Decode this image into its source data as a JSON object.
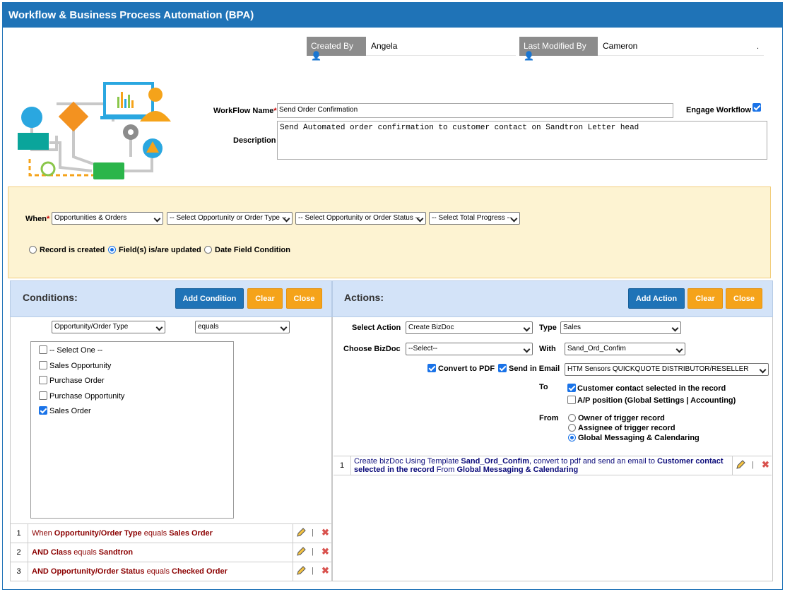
{
  "title": "Workflow & Business Process Automation (BPA)",
  "meta": {
    "created_by_label": "Created By",
    "created_by_value": "Angela",
    "modified_by_label": "Last Modified By",
    "modified_by_value": "Cameron",
    "trailing_dot": "."
  },
  "form": {
    "name_label": "WorkFlow Name",
    "name_value": "Send Order Confirmation",
    "description_label": "Description",
    "description_value": "Send Automated order confirmation to customer contact on Sandtron Letter head",
    "engage_label": "Engage Workflow",
    "engage_checked": true
  },
  "when": {
    "label": "When",
    "module_select": "Opportunities & Orders",
    "type_select": "-- Select Opportunity or Order Type --",
    "status_select": "-- Select Opportunity or Order Status --",
    "progress_select": "-- Select Total Progress --",
    "radios": [
      "Record is created",
      "Field(s) is/are updated",
      "Date Field Condition"
    ],
    "selected_radio": 1
  },
  "conditions": {
    "title": "Conditions:",
    "add_label": "Add Condition",
    "clear_label": "Clear",
    "close_label": "Close",
    "field_select": "Opportunity/Order Type",
    "operator_select": "equals",
    "options": [
      {
        "label": "-- Select One --",
        "checked": false
      },
      {
        "label": "Sales Opportunity",
        "checked": false
      },
      {
        "label": "Purchase Order",
        "checked": false
      },
      {
        "label": "Purchase Opportunity",
        "checked": false
      },
      {
        "label": "Sales Order",
        "checked": true
      }
    ],
    "rows": [
      {
        "num": "1",
        "p1": "When ",
        "b1": "Opportunity/Order Type",
        "p2": " equals ",
        "b2": "Sales Order"
      },
      {
        "num": "2",
        "p1": "",
        "b1": "AND Class",
        "p2": " equals ",
        "b2": "Sandtron"
      },
      {
        "num": "3",
        "p1": "",
        "b1": "AND Opportunity/Order Status",
        "p2": " equals ",
        "b2": "Checked Order"
      }
    ]
  },
  "actions": {
    "title": "Actions:",
    "add_label": "Add Action",
    "clear_label": "Clear",
    "close_label": "Close",
    "select_action_label": "Select Action",
    "select_action_value": "Create BizDoc",
    "type_label": "Type",
    "type_value": "Sales",
    "choose_bizdoc_label": "Choose BizDoc",
    "choose_bizdoc_value": "--Select--",
    "with_label": "With",
    "with_value": "Sand_Ord_Confim",
    "convert_pdf_label": "Convert to PDF",
    "send_email_label": "Send in Email",
    "email_template_value": "HTM Sensors QUICKQUOTE DISTRIBUTOR/RESELLER",
    "to_label": "To",
    "to_options": [
      {
        "label": "Customer contact selected in the record",
        "checked": true
      },
      {
        "label": "A/P position (Global Settings | Accounting)",
        "checked": false
      }
    ],
    "from_label": "From",
    "from_options": [
      "Owner of trigger record",
      "Assignee of trigger record",
      "Global Messaging & Calendaring"
    ],
    "from_selected": 2,
    "row": {
      "num": "1",
      "t1": "Create bizDoc  Using Template ",
      "b1": "Sand_Ord_Confim",
      "t2": ", convert to pdf and send an email to ",
      "b2": "Customer contact selected in the record",
      "t3": " From ",
      "b3": "Global Messaging & Calendaring"
    }
  },
  "colors": {
    "header_blue": "#1f73b7",
    "accent_orange": "#f5a31a",
    "when_bg": "#fdf3d2",
    "panel_head": "#d3e3f8"
  }
}
